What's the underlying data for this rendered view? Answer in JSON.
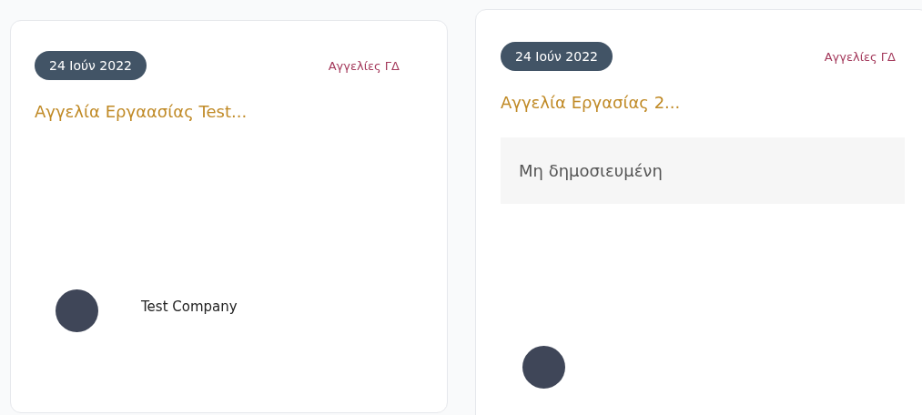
{
  "cards": [
    {
      "date": "24 Ιούν 2022",
      "category": "Αγγελίες ΓΔ",
      "title": "Αγγελία Εργαασίας Test...",
      "company": "Test Company"
    },
    {
      "date": "24 Ιούν 2022",
      "category": "Αγγελίες ΓΔ",
      "title": "Αγγελία Εργασίας 2...",
      "status": "Μη δημοσιευμένη"
    }
  ]
}
